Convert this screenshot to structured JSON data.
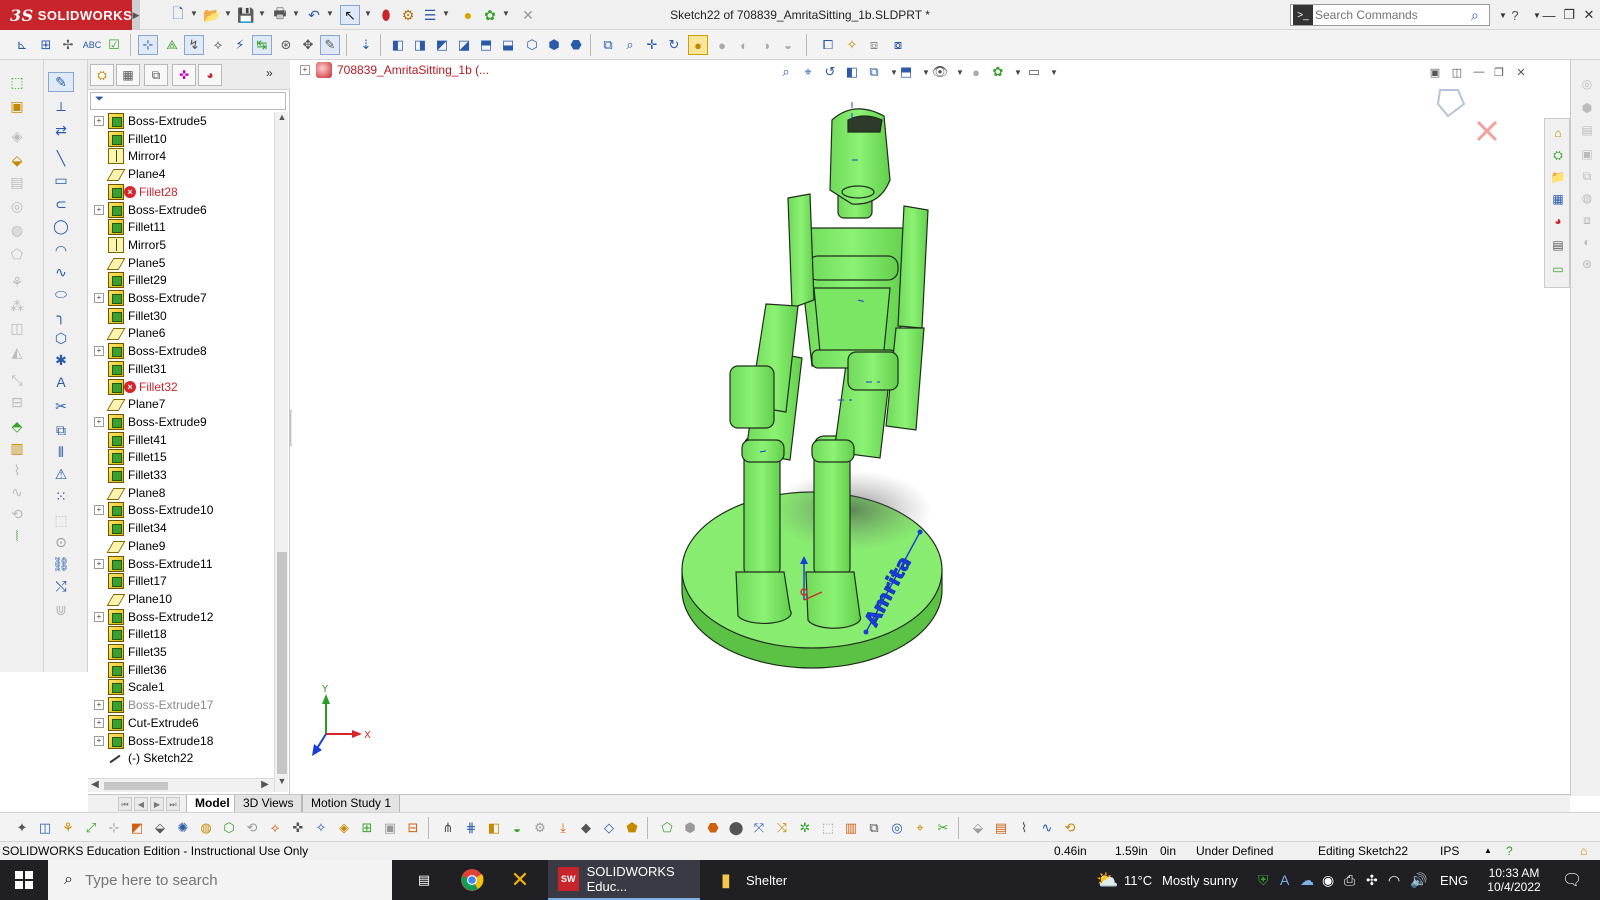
{
  "app": {
    "brand": "SOLIDWORKS",
    "window_title": "Sketch22 of 708839_AmritaSitting_1b.SLDPRT *",
    "search_placeholder": "Search Commands"
  },
  "colors": {
    "brand_red": "#c8242c",
    "model_green": "#86ec6e",
    "model_edge": "#1f2d1b",
    "sketch_blue": "#1a3cd8",
    "error_red": "#d7262a"
  },
  "feature_tree": {
    "items": [
      {
        "label": "Boss-Extrude5",
        "icon": "feature-icon",
        "expandable": true,
        "state": "normal"
      },
      {
        "label": "Fillet10",
        "icon": "fillet-icon",
        "expandable": false,
        "state": "normal"
      },
      {
        "label": "Mirror4",
        "icon": "mirror-icon",
        "expandable": false,
        "state": "normal"
      },
      {
        "label": "Plane4",
        "icon": "plane-icon",
        "expandable": false,
        "state": "normal"
      },
      {
        "label": "Fillet28",
        "icon": "fillet-icon",
        "expandable": false,
        "state": "error"
      },
      {
        "label": "Boss-Extrude6",
        "icon": "feature-icon",
        "expandable": true,
        "state": "normal"
      },
      {
        "label": "Fillet11",
        "icon": "fillet-icon",
        "expandable": false,
        "state": "normal"
      },
      {
        "label": "Mirror5",
        "icon": "mirror-icon",
        "expandable": false,
        "state": "normal"
      },
      {
        "label": "Plane5",
        "icon": "plane-icon",
        "expandable": false,
        "state": "normal"
      },
      {
        "label": "Fillet29",
        "icon": "fillet-icon",
        "expandable": false,
        "state": "normal"
      },
      {
        "label": "Boss-Extrude7",
        "icon": "feature-icon",
        "expandable": true,
        "state": "normal"
      },
      {
        "label": "Fillet30",
        "icon": "fillet-icon",
        "expandable": false,
        "state": "normal"
      },
      {
        "label": "Plane6",
        "icon": "plane-icon",
        "expandable": false,
        "state": "normal"
      },
      {
        "label": "Boss-Extrude8",
        "icon": "feature-icon",
        "expandable": true,
        "state": "normal"
      },
      {
        "label": "Fillet31",
        "icon": "fillet-icon",
        "expandable": false,
        "state": "normal"
      },
      {
        "label": "Fillet32",
        "icon": "fillet-icon",
        "expandable": false,
        "state": "error"
      },
      {
        "label": "Plane7",
        "icon": "plane-icon",
        "expandable": false,
        "state": "normal"
      },
      {
        "label": "Boss-Extrude9",
        "icon": "feature-icon",
        "expandable": true,
        "state": "normal"
      },
      {
        "label": "Fillet41",
        "icon": "fillet-icon",
        "expandable": false,
        "state": "normal"
      },
      {
        "label": "Fillet15",
        "icon": "fillet-icon",
        "expandable": false,
        "state": "normal"
      },
      {
        "label": "Fillet33",
        "icon": "fillet-icon",
        "expandable": false,
        "state": "normal"
      },
      {
        "label": "Plane8",
        "icon": "plane-icon",
        "expandable": false,
        "state": "normal"
      },
      {
        "label": "Boss-Extrude10",
        "icon": "feature-icon",
        "expandable": true,
        "state": "normal"
      },
      {
        "label": "Fillet34",
        "icon": "fillet-icon",
        "expandable": false,
        "state": "normal"
      },
      {
        "label": "Plane9",
        "icon": "plane-icon",
        "expandable": false,
        "state": "normal"
      },
      {
        "label": "Boss-Extrude11",
        "icon": "feature-icon",
        "expandable": true,
        "state": "normal"
      },
      {
        "label": "Fillet17",
        "icon": "fillet-icon",
        "expandable": false,
        "state": "normal"
      },
      {
        "label": "Plane10",
        "icon": "plane-icon",
        "expandable": false,
        "state": "normal"
      },
      {
        "label": "Boss-Extrude12",
        "icon": "feature-icon",
        "expandable": true,
        "state": "normal"
      },
      {
        "label": "Fillet18",
        "icon": "fillet-icon",
        "expandable": false,
        "state": "normal"
      },
      {
        "label": "Fillet35",
        "icon": "fillet-icon",
        "expandable": false,
        "state": "normal"
      },
      {
        "label": "Fillet36",
        "icon": "fillet-icon",
        "expandable": false,
        "state": "normal"
      },
      {
        "label": "Scale1",
        "icon": "scale-icon",
        "expandable": false,
        "state": "normal"
      },
      {
        "label": "Boss-Extrude17",
        "icon": "feature-icon",
        "expandable": true,
        "state": "suppressed"
      },
      {
        "label": "Cut-Extrude6",
        "icon": "feature-icon",
        "expandable": true,
        "state": "normal"
      },
      {
        "label": "Boss-Extrude18",
        "icon": "feature-icon",
        "expandable": true,
        "state": "normal"
      },
      {
        "label": "(-) Sketch22",
        "icon": "sketch-icon",
        "expandable": false,
        "state": "normal"
      }
    ]
  },
  "viewport": {
    "part_name": "708839_AmritaSitting_1b  (...",
    "model_text": "Amrita",
    "axis_x": "X",
    "axis_y": "Y"
  },
  "bottom_tabs": [
    {
      "label": "Model",
      "active": true
    },
    {
      "label": "3D Views",
      "active": false
    },
    {
      "label": "Motion Study 1",
      "active": false
    }
  ],
  "status_bar": {
    "edition": "SOLIDWORKS Education Edition - Instructional Use Only",
    "x_coord": "0.46in",
    "y_coord": "1.59in",
    "z_coord": "0in",
    "sketch_state": "Under Defined",
    "editing": "Editing Sketch22",
    "units": "IPS"
  },
  "taskbar": {
    "search_placeholder": "Type here to search",
    "apps": [
      {
        "label": "SOLIDWORKS Educ...",
        "active": true
      },
      {
        "label": "Shelter",
        "active": false
      }
    ],
    "weather_temp": "11°C",
    "weather_desc": "Mostly sunny",
    "language": "ENG",
    "time": "10:33 AM",
    "date": "10/4/2022"
  }
}
